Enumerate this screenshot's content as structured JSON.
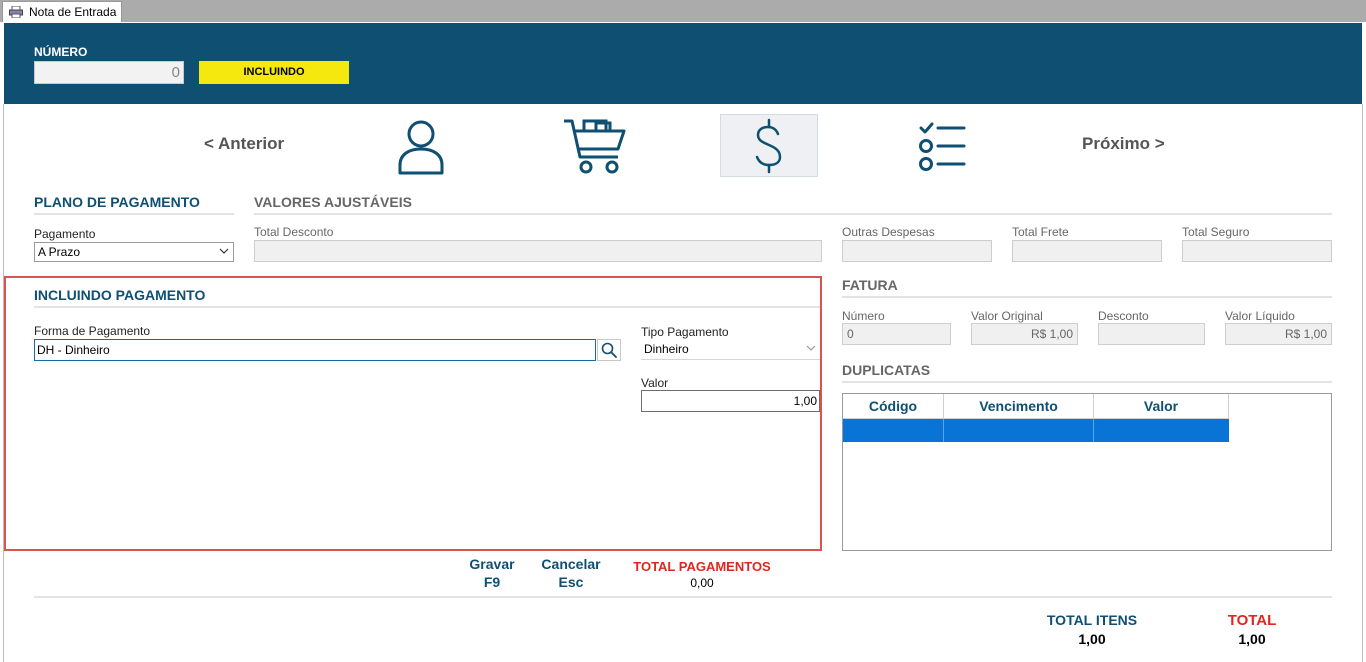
{
  "tab": {
    "label": "Nota de Entrada",
    "icon": "printer-icon"
  },
  "header": {
    "numero_label": "NÚMERO",
    "numero_value": "0",
    "status": "INCLUINDO",
    "bg_color": "#0e4f72",
    "status_color": "#f4e80e"
  },
  "nav": {
    "prev_label": "< Anterior",
    "next_label": "Próximo >",
    "steps": [
      {
        "icon": "person-icon",
        "active": false
      },
      {
        "icon": "cart-icon",
        "active": false
      },
      {
        "icon": "dollar-icon",
        "active": true
      },
      {
        "icon": "checklist-icon",
        "active": false
      }
    ]
  },
  "plano": {
    "title": "PLANO DE PAGAMENTO",
    "pagamento_label": "Pagamento",
    "pagamento_value": "A Prazo"
  },
  "valores": {
    "title": "VALORES AJUSTÁVEIS",
    "total_desconto_label": "Total Desconto",
    "outras_despesas_label": "Outras Despesas",
    "total_frete_label": "Total Frete",
    "total_seguro_label": "Total Seguro"
  },
  "incluindo": {
    "title": "INCLUINDO PAGAMENTO",
    "forma_label": "Forma de Pagamento",
    "forma_value": "DH - Dinheiro",
    "tipo_label": "Tipo Pagamento",
    "tipo_value": "Dinheiro",
    "valor_label": "Valor",
    "valor_value": "1,00",
    "border_color": "#d9534f"
  },
  "fatura": {
    "title": "FATURA",
    "numero_label": "Número",
    "numero_value": "0",
    "valor_original_label": "Valor Original",
    "valor_original_value": "R$ 1,00",
    "desconto_label": "Desconto",
    "desconto_value": "",
    "valor_liquido_label": "Valor Líquido",
    "valor_liquido_value": "R$ 1,00"
  },
  "duplicatas": {
    "title": "DUPLICATAS",
    "columns": [
      "Código",
      "Vencimento",
      "Valor"
    ],
    "rows": [
      [
        "",
        "",
        ""
      ]
    ],
    "selected_color": "#0a74d6"
  },
  "actions": {
    "gravar_label": "Gravar",
    "gravar_key": "F9",
    "cancelar_label": "Cancelar",
    "cancelar_key": "Esc"
  },
  "totals": {
    "pagamentos_label": "TOTAL PAGAMENTOS",
    "pagamentos_value": "0,00",
    "itens_label": "TOTAL ITENS",
    "itens_value": "1,00",
    "total_label": "TOTAL",
    "total_value": "1,00",
    "red_color": "#e0261e"
  }
}
